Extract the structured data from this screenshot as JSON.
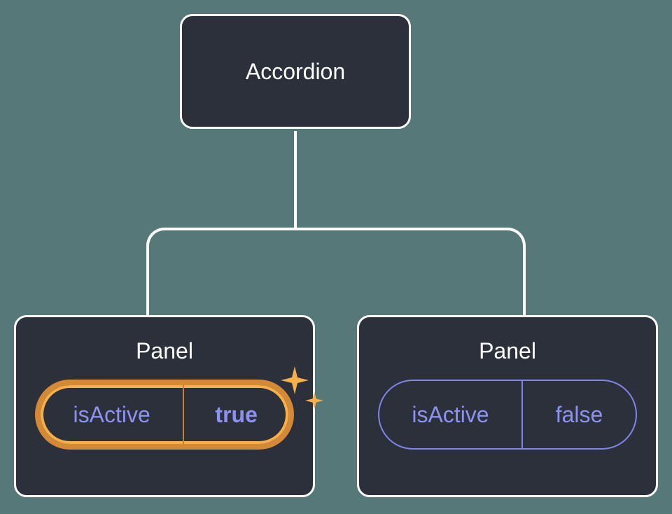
{
  "root": {
    "label": "Accordion"
  },
  "panels": [
    {
      "label": "Panel",
      "prop_key": "isActive",
      "prop_value": "true",
      "highlighted": true
    },
    {
      "label": "Panel",
      "prop_key": "isActive",
      "prop_value": "false",
      "highlighted": false
    }
  ],
  "colors": {
    "background": "#577878",
    "node_fill": "#2b303b",
    "node_border": "#ffffff",
    "prop_text": "#8d91ef",
    "pill_inactive_border": "#8185e8",
    "pill_active_outer": "#d38936",
    "pill_active_inner": "#f5b04a"
  }
}
